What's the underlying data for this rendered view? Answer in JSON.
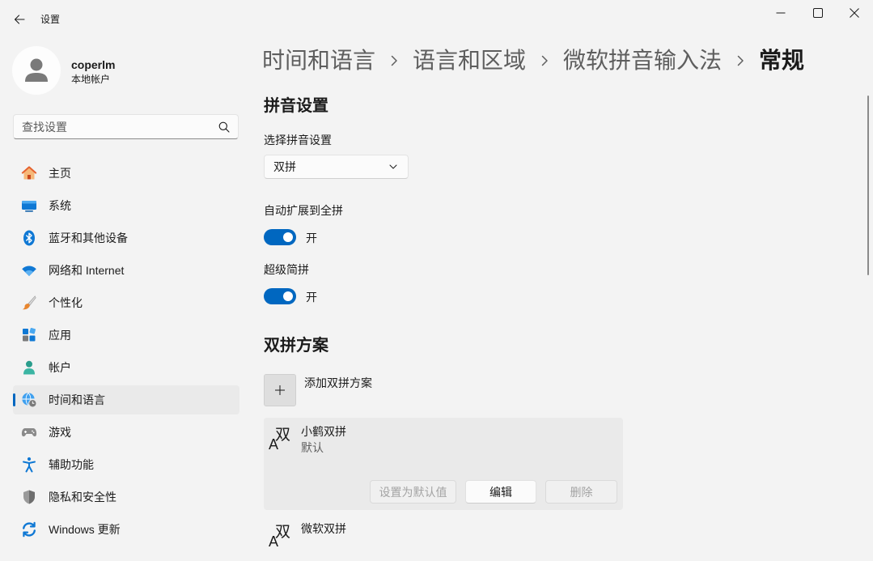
{
  "window": {
    "title": "设置",
    "back_icon": "back-arrow-icon",
    "controls": [
      "minimize-icon",
      "maximize-icon",
      "close-icon"
    ]
  },
  "user": {
    "name": "coperlm",
    "account_type": "本地帐户",
    "avatar_icon": "person-icon"
  },
  "search": {
    "placeholder": "查找设置",
    "icon": "search-icon"
  },
  "nav": [
    {
      "label": "主页",
      "icon": "home-icon",
      "selected": false
    },
    {
      "label": "系统",
      "icon": "system-icon",
      "selected": false
    },
    {
      "label": "蓝牙和其他设备",
      "icon": "bluetooth-icon",
      "selected": false
    },
    {
      "label": "网络和 Internet",
      "icon": "wifi-icon",
      "selected": false
    },
    {
      "label": "个性化",
      "icon": "brush-icon",
      "selected": false
    },
    {
      "label": "应用",
      "icon": "apps-icon",
      "selected": false
    },
    {
      "label": "帐户",
      "icon": "account-icon",
      "selected": false
    },
    {
      "label": "时间和语言",
      "icon": "time-language-icon",
      "selected": true
    },
    {
      "label": "游戏",
      "icon": "gamepad-icon",
      "selected": false
    },
    {
      "label": "辅助功能",
      "icon": "accessibility-icon",
      "selected": false
    },
    {
      "label": "隐私和安全性",
      "icon": "shield-icon",
      "selected": false
    },
    {
      "label": "Windows 更新",
      "icon": "windows-update-icon",
      "selected": false
    }
  ],
  "breadcrumb": [
    "时间和语言",
    "语言和区域",
    "微软拼音输入法",
    "常规"
  ],
  "pinyin_settings": {
    "heading": "拼音设置",
    "mode_label": "选择拼音设置",
    "mode_value": "双拼",
    "auto_expand": {
      "label": "自动扩展到全拼",
      "state_label": "开",
      "on": true
    },
    "super_abbrev": {
      "label": "超级简拼",
      "state_label": "开",
      "on": true
    }
  },
  "shuangpin": {
    "heading": "双拼方案",
    "add_label": "添加双拼方案",
    "add_icon": "plus-icon",
    "icon_glyphs": {
      "latin": "A",
      "cjk": "双"
    },
    "schemes": [
      {
        "name": "小鹤双拼",
        "status": "默认",
        "expanded": true,
        "actions": [
          {
            "label": "设置为默认值",
            "enabled": false
          },
          {
            "label": "编辑",
            "enabled": true
          },
          {
            "label": "删除",
            "enabled": false
          }
        ]
      },
      {
        "name": "微软双拼",
        "expanded": false
      }
    ]
  },
  "colors": {
    "accent": "#0067c0",
    "background": "#f3f3f3",
    "selected_nav": "#eaeaea",
    "card": "#eaeaea"
  }
}
